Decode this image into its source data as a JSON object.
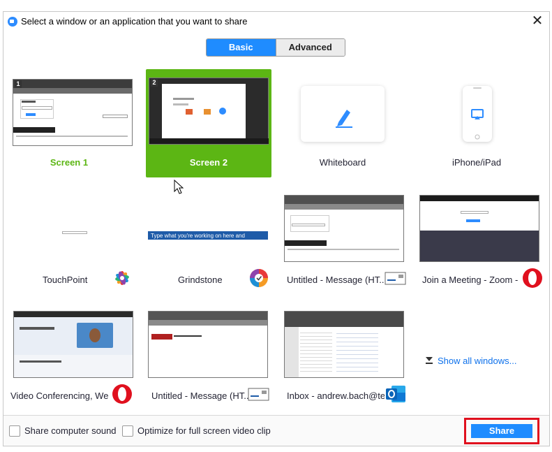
{
  "window": {
    "title": "Select a window or an application that you want to share"
  },
  "tabs": {
    "basic": "Basic",
    "advanced": "Advanced"
  },
  "thumbs": {
    "screen1_number": "1",
    "screen2_number": "2"
  },
  "screens": [
    {
      "label": "Screen 1"
    },
    {
      "label": "Screen 2"
    },
    {
      "label": "Whiteboard"
    },
    {
      "label": "iPhone/iPad"
    }
  ],
  "windows": [
    {
      "label": "TouchPoint",
      "icon": "touchpoint-app-icon"
    },
    {
      "label": "Grindstone",
      "icon": "grindstone-app-icon",
      "thumb_text": "Type what you're working on here and"
    },
    {
      "label": "Untitled - Message (HT...",
      "icon": "outlook-message-icon"
    },
    {
      "label": "Join a Meeting - Zoom - ...",
      "icon": "opera-icon"
    },
    {
      "label": "Video Conferencing, We...",
      "icon": "opera-icon"
    },
    {
      "label": "Untitled - Message (HT...",
      "icon": "outlook-message-icon"
    },
    {
      "label": "Inbox - andrew.bach@te...",
      "icon": "outlook-icon"
    }
  ],
  "show_all": "Show all windows...",
  "footer": {
    "share_sound": "Share computer sound",
    "optimize_video": "Optimize for full screen video clip",
    "share_button": "Share"
  },
  "colors": {
    "accent": "#1f8cff",
    "selected": "#5cb614",
    "highlight": "#e0101e"
  }
}
